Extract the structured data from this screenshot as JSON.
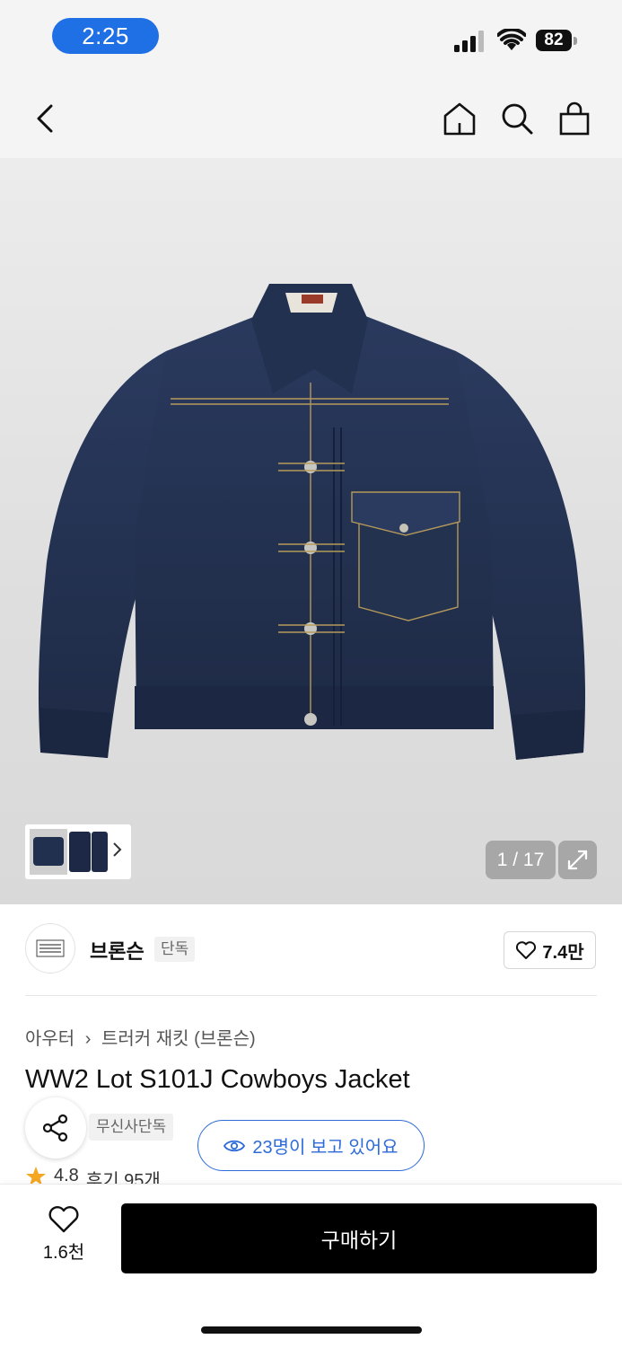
{
  "status_bar": {
    "time": "2:25",
    "battery": "82"
  },
  "nav": {
    "icons": [
      "back-icon",
      "home-icon",
      "search-icon",
      "shopping-bag-icon"
    ]
  },
  "gallery": {
    "counter": "1 / 17"
  },
  "brand": {
    "name": "브론슨",
    "tag": "단독",
    "likes": "7.4만"
  },
  "product": {
    "category": "아우터",
    "subcategory": "트러커 재킷 (브론슨)",
    "title": "WW2 Lot S101J Cowboys Jacket",
    "exclusive_tag": "무신사단독",
    "viewers": "23명이 보고 있어요",
    "rating": "4.8",
    "reviews": "후기 95개"
  },
  "bottom_bar": {
    "wish_count": "1.6천",
    "buy_label": "구매하기"
  },
  "colors": {
    "accent_blue": "#2d6bd8",
    "status_pill": "#1f6fe5",
    "denim": "#22304f",
    "star": "#f5a623"
  }
}
